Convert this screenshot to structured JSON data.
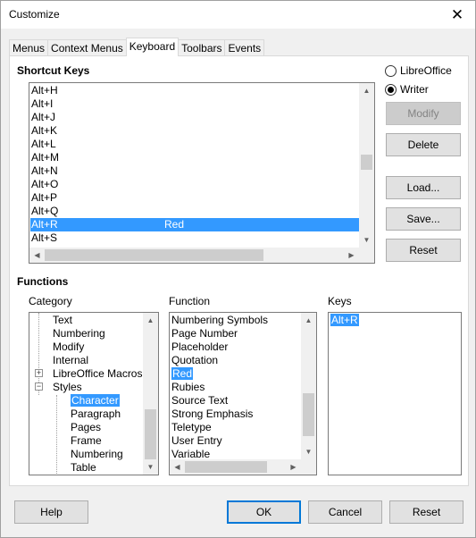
{
  "window": {
    "title": "Customize"
  },
  "tabs": [
    "Menus",
    "Context Menus",
    "Keyboard",
    "Toolbars",
    "Events"
  ],
  "shortcut_keys": {
    "title": "Shortcut Keys",
    "rows": [
      {
        "key": "Alt+H",
        "command": ""
      },
      {
        "key": "Alt+I",
        "command": ""
      },
      {
        "key": "Alt+J",
        "command": ""
      },
      {
        "key": "Alt+K",
        "command": ""
      },
      {
        "key": "Alt+L",
        "command": ""
      },
      {
        "key": "Alt+M",
        "command": ""
      },
      {
        "key": "Alt+N",
        "command": ""
      },
      {
        "key": "Alt+O",
        "command": ""
      },
      {
        "key": "Alt+P",
        "command": ""
      },
      {
        "key": "Alt+Q",
        "command": ""
      },
      {
        "key": "Alt+R",
        "command": "Red"
      },
      {
        "key": "Alt+S",
        "command": ""
      }
    ]
  },
  "scope": {
    "libreoffice": "LibreOffice",
    "writer": "Writer"
  },
  "buttons": {
    "modify": "Modify",
    "delete": "Delete",
    "load": "Load...",
    "save": "Save...",
    "reset_right": "Reset",
    "help": "Help",
    "ok": "OK",
    "cancel": "Cancel",
    "reset_bottom": "Reset"
  },
  "functions": {
    "title": "Functions",
    "category_label": "Category",
    "function_label": "Function",
    "keys_label": "Keys",
    "categories": [
      "Text",
      "Numbering",
      "Modify",
      "Internal",
      "LibreOffice Macros",
      "Styles",
      "Character",
      "Paragraph",
      "Pages",
      "Frame",
      "Numbering",
      "Table"
    ],
    "function_items": [
      "Numbering Symbols",
      "Page Number",
      "Placeholder",
      "Quotation",
      "Red",
      "Rubies",
      "Source Text",
      "Strong Emphasis",
      "Teletype",
      "User Entry",
      "Variable"
    ],
    "keys": [
      "Alt+R"
    ]
  }
}
